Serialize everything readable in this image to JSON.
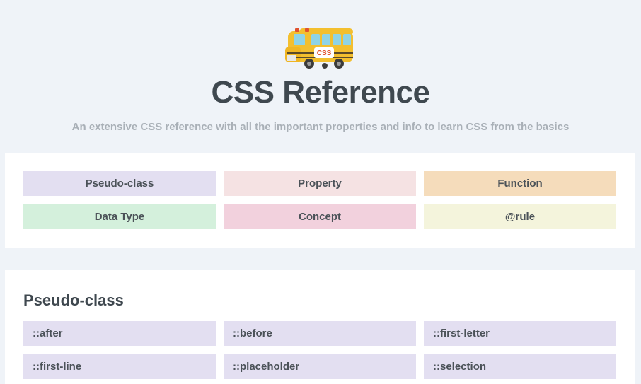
{
  "header": {
    "title": "CSS Reference",
    "subtitle": "An extensive CSS reference with all the important properties and info to learn CSS from the basics",
    "logo": {
      "icon": "school-bus-icon",
      "badge_text": "CSS"
    }
  },
  "legend": {
    "items": [
      {
        "label": "Pseudo-class",
        "color": "#e3dff1"
      },
      {
        "label": "Property",
        "color": "#f5e2e3"
      },
      {
        "label": "Function",
        "color": "#f5dcbb"
      },
      {
        "label": "Data Type",
        "color": "#d4f0dc"
      },
      {
        "label": "Concept",
        "color": "#f2d1dd"
      },
      {
        "label": "@rule",
        "color": "#f4f4dc"
      }
    ]
  },
  "section": {
    "title": "Pseudo-class",
    "color": "#e3dff1",
    "items": [
      "::after",
      "::before",
      "::first-letter",
      "::first-line",
      "::placeholder",
      "::selection"
    ]
  }
}
